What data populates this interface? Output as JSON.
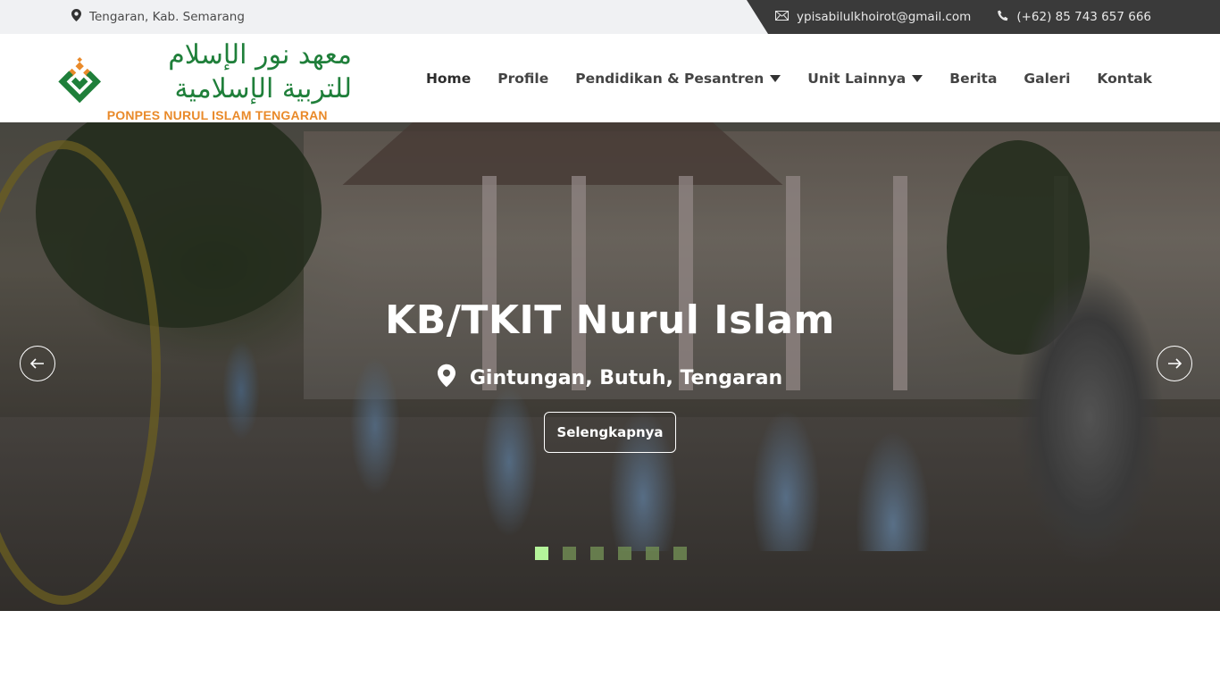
{
  "topbar": {
    "location": "Tengaran, Kab. Semarang",
    "email": "ypisabilulkhoirot@gmail.com",
    "phone": "(+62) 85 743 657 666"
  },
  "brand": {
    "arabic": "معهد نور الإسلام للتربية الإسلامية",
    "name": "PONPES NURUL ISLAM TENGARAN",
    "colors": {
      "green": "#1f7f3a",
      "orange": "#e98a2a"
    }
  },
  "nav": {
    "items": [
      {
        "label": "Home",
        "active": true
      },
      {
        "label": "Profile"
      },
      {
        "label": "Pendidikan & Pesantren",
        "dropdown": true
      },
      {
        "label": "Unit Lainnya",
        "dropdown": true
      },
      {
        "label": "Berita"
      },
      {
        "label": "Galeri"
      },
      {
        "label": "Kontak"
      }
    ]
  },
  "hero": {
    "title": "KB/TKIT Nurul Islam",
    "location": "Gintungan, Butuh, Tengaran",
    "button": "Selengkapnya",
    "slide_count": 6,
    "active_slide": 1,
    "colors": {
      "active_dot": "#b4f49a",
      "inactive_dot": "#6f8a52"
    }
  },
  "icons": {
    "location": "map-pin-icon",
    "email": "envelope-icon",
    "phone": "phone-icon",
    "prev": "arrow-left-icon",
    "next": "arrow-right-icon"
  }
}
